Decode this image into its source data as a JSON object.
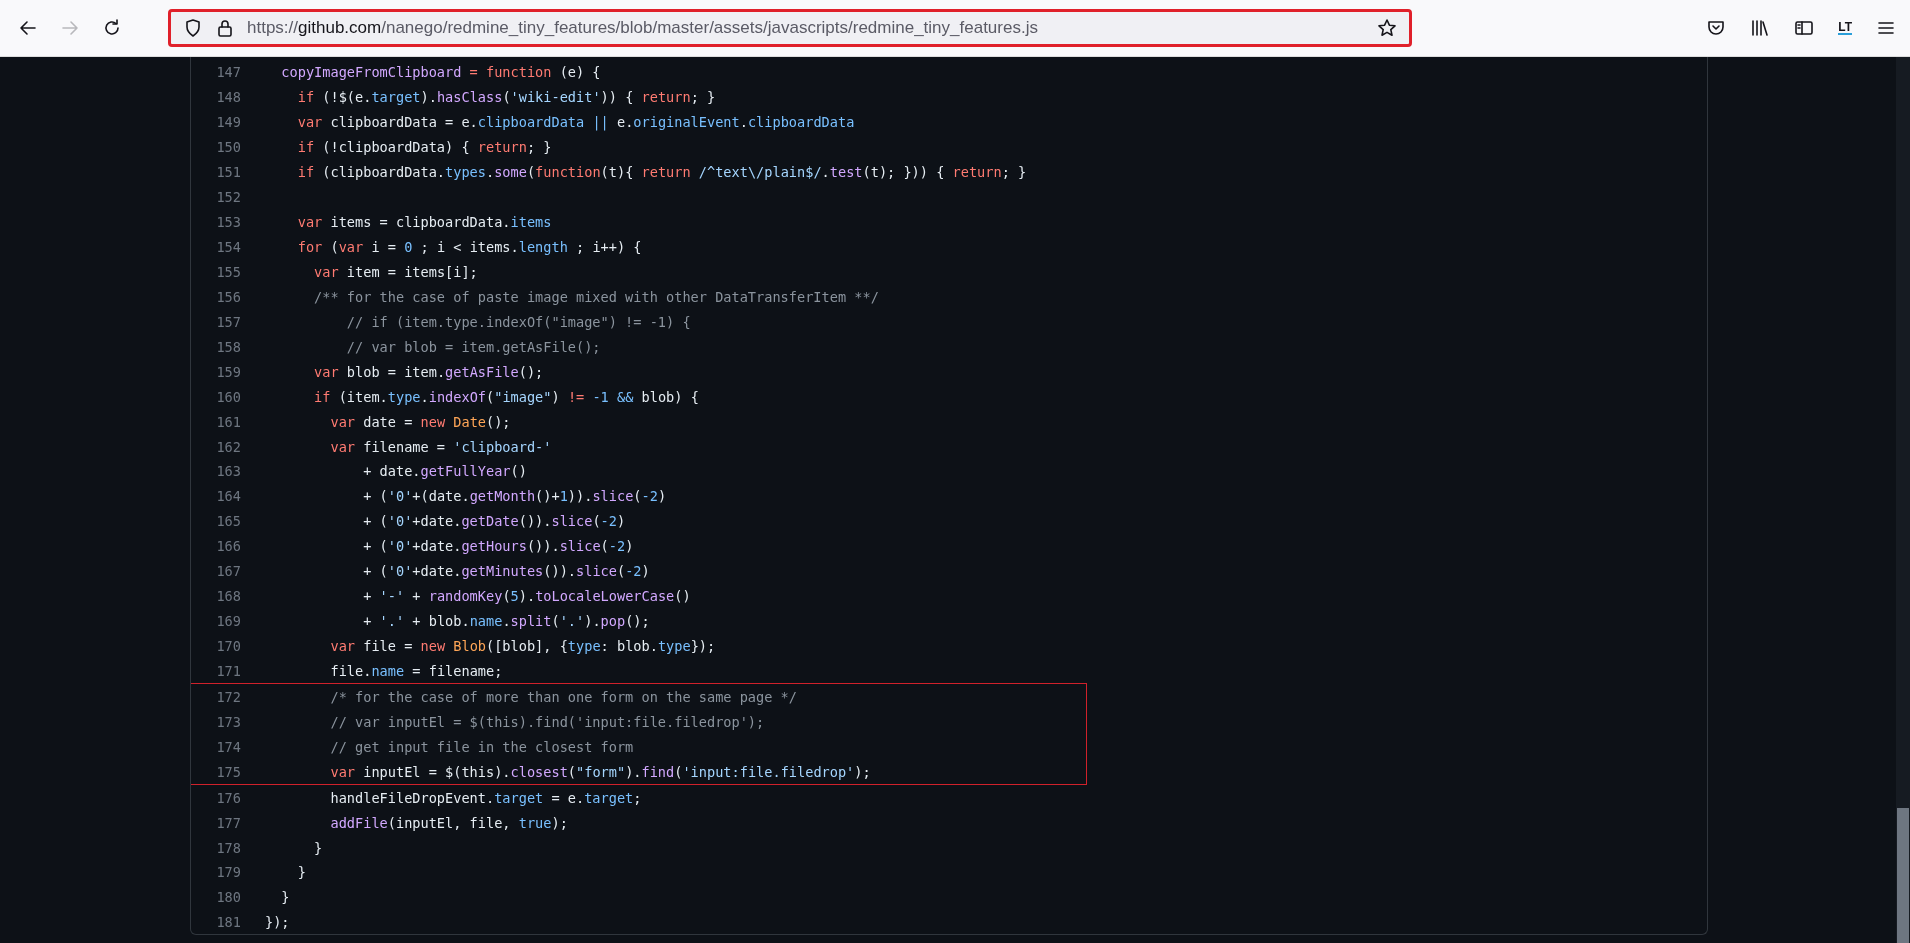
{
  "toolbar": {
    "forward_disabled": true,
    "address_bar": {
      "highlighted": true,
      "url_scheme": "https://",
      "url_host": "github.com",
      "url_path": "/nanego/redmine_tiny_features/blob/master/assets/javascripts/redmine_tiny_features.js"
    },
    "extension_label": "LT"
  },
  "code": {
    "lines": [
      {
        "number": "147",
        "boxed": false,
        "tokens": [
          {
            "kind": "fn",
            "text": "  copyImageFromClipboard"
          },
          {
            "kind": "kw",
            "text": " = function"
          },
          {
            "kind": "txt",
            "text": " (e) {"
          }
        ]
      },
      {
        "number": "148",
        "boxed": false,
        "tokens": [
          {
            "kind": "kw",
            "text": "    if"
          },
          {
            "kind": "txt",
            "text": " (!$(e."
          },
          {
            "kind": "prop",
            "text": "target"
          },
          {
            "kind": "txt",
            "text": ")."
          },
          {
            "kind": "fn",
            "text": "hasClass"
          },
          {
            "kind": "txt",
            "text": "("
          },
          {
            "kind": "str",
            "text": "'wiki-edit'"
          },
          {
            "kind": "txt",
            "text": ")) { "
          },
          {
            "kind": "kw",
            "text": "return"
          },
          {
            "kind": "txt",
            "text": "; }"
          }
        ]
      },
      {
        "number": "149",
        "boxed": false,
        "tokens": [
          {
            "kind": "kw",
            "text": "    var"
          },
          {
            "kind": "txt",
            "text": " clipboardData = e."
          },
          {
            "kind": "prop",
            "text": "clipboardData"
          },
          {
            "kind": "prop",
            "text": " ||"
          },
          {
            "kind": "txt",
            "text": " e."
          },
          {
            "kind": "prop",
            "text": "originalEvent"
          },
          {
            "kind": "txt",
            "text": "."
          },
          {
            "kind": "prop",
            "text": "clipboardData"
          }
        ]
      },
      {
        "number": "150",
        "boxed": false,
        "tokens": [
          {
            "kind": "kw",
            "text": "    if"
          },
          {
            "kind": "txt",
            "text": " (!clipboardData) { "
          },
          {
            "kind": "kw",
            "text": "return"
          },
          {
            "kind": "txt",
            "text": "; }"
          }
        ]
      },
      {
        "number": "151",
        "boxed": false,
        "tokens": [
          {
            "kind": "kw",
            "text": "    if"
          },
          {
            "kind": "txt",
            "text": " (clipboardData."
          },
          {
            "kind": "prop",
            "text": "types"
          },
          {
            "kind": "txt",
            "text": "."
          },
          {
            "kind": "fn",
            "text": "some"
          },
          {
            "kind": "txt",
            "text": "("
          },
          {
            "kind": "kw",
            "text": "function"
          },
          {
            "kind": "txt",
            "text": "(t){ "
          },
          {
            "kind": "kw",
            "text": "return"
          },
          {
            "kind": "str",
            "text": " /^text\\/plain$/"
          },
          {
            "kind": "txt",
            "text": "."
          },
          {
            "kind": "fn",
            "text": "test"
          },
          {
            "kind": "txt",
            "text": "(t); })) { "
          },
          {
            "kind": "kw",
            "text": "return"
          },
          {
            "kind": "txt",
            "text": "; }"
          }
        ]
      },
      {
        "number": "152",
        "boxed": false
      },
      {
        "number": "153",
        "boxed": false,
        "tokens": [
          {
            "kind": "kw",
            "text": "    var"
          },
          {
            "kind": "txt",
            "text": " items = clipboardData."
          },
          {
            "kind": "prop",
            "text": "items"
          }
        ]
      },
      {
        "number": "154",
        "boxed": false,
        "tokens": [
          {
            "kind": "kw",
            "text": "    for"
          },
          {
            "kind": "txt",
            "text": " ("
          },
          {
            "kind": "kw",
            "text": "var"
          },
          {
            "kind": "txt",
            "text": " i = "
          },
          {
            "kind": "num",
            "text": "0"
          },
          {
            "kind": "txt",
            "text": " ; i < items."
          },
          {
            "kind": "prop",
            "text": "length"
          },
          {
            "kind": "txt",
            "text": " ; i++) {"
          }
        ]
      },
      {
        "number": "155",
        "boxed": false,
        "tokens": [
          {
            "kind": "kw",
            "text": "      var"
          },
          {
            "kind": "txt",
            "text": " item = items[i];"
          }
        ]
      },
      {
        "number": "156",
        "boxed": false,
        "tokens": [
          {
            "kind": "cmt",
            "text": "      /** for the case of paste image mixed with other DataTransferItem **/"
          }
        ]
      },
      {
        "number": "157",
        "boxed": false,
        "tokens": [
          {
            "kind": "cmt",
            "text": "          // if (item.type.indexOf(\"image\") != -1) {"
          }
        ]
      },
      {
        "number": "158",
        "boxed": false,
        "tokens": [
          {
            "kind": "cmt",
            "text": "          // var blob = item.getAsFile();"
          }
        ]
      },
      {
        "number": "159",
        "boxed": false,
        "tokens": [
          {
            "kind": "kw",
            "text": "      var"
          },
          {
            "kind": "txt",
            "text": " blob = item."
          },
          {
            "kind": "fn",
            "text": "getAsFile"
          },
          {
            "kind": "txt",
            "text": "();"
          }
        ]
      },
      {
        "number": "160",
        "boxed": false,
        "tokens": [
          {
            "kind": "kw",
            "text": "      if"
          },
          {
            "kind": "txt",
            "text": " (item."
          },
          {
            "kind": "prop",
            "text": "type"
          },
          {
            "kind": "txt",
            "text": "."
          },
          {
            "kind": "fn",
            "text": "indexOf"
          },
          {
            "kind": "txt",
            "text": "("
          },
          {
            "kind": "str",
            "text": "\"image\""
          },
          {
            "kind": "txt",
            "text": ") "
          },
          {
            "kind": "kw",
            "text": "!="
          },
          {
            "kind": "num",
            "text": " -1"
          },
          {
            "kind": "prop",
            "text": " &&"
          },
          {
            "kind": "txt",
            "text": " blob) {"
          }
        ]
      },
      {
        "number": "161",
        "boxed": false,
        "tokens": [
          {
            "kind": "kw",
            "text": "        var"
          },
          {
            "kind": "txt",
            "text": " date = "
          },
          {
            "kind": "kw",
            "text": "new"
          },
          {
            "kind": "cls",
            "text": " Date"
          },
          {
            "kind": "txt",
            "text": "();"
          }
        ]
      },
      {
        "number": "162",
        "boxed": false,
        "tokens": [
          {
            "kind": "kw",
            "text": "        var"
          },
          {
            "kind": "txt",
            "text": " filename = "
          },
          {
            "kind": "str",
            "text": "'clipboard-'"
          }
        ]
      },
      {
        "number": "163",
        "boxed": false,
        "tokens": [
          {
            "kind": "txt",
            "text": "            + date."
          },
          {
            "kind": "fn",
            "text": "getFullYear"
          },
          {
            "kind": "txt",
            "text": "()"
          }
        ]
      },
      {
        "number": "164",
        "boxed": false,
        "tokens": [
          {
            "kind": "txt",
            "text": "            + ("
          },
          {
            "kind": "str",
            "text": "'0'"
          },
          {
            "kind": "txt",
            "text": "+(date."
          },
          {
            "kind": "fn",
            "text": "getMonth"
          },
          {
            "kind": "txt",
            "text": "()+"
          },
          {
            "kind": "num",
            "text": "1"
          },
          {
            "kind": "txt",
            "text": "))."
          },
          {
            "kind": "fn",
            "text": "slice"
          },
          {
            "kind": "txt",
            "text": "("
          },
          {
            "kind": "num",
            "text": "-2"
          },
          {
            "kind": "txt",
            "text": ")"
          }
        ]
      },
      {
        "number": "165",
        "boxed": false,
        "tokens": [
          {
            "kind": "txt",
            "text": "            + ("
          },
          {
            "kind": "str",
            "text": "'0'"
          },
          {
            "kind": "txt",
            "text": "+date."
          },
          {
            "kind": "fn",
            "text": "getDate"
          },
          {
            "kind": "txt",
            "text": "())."
          },
          {
            "kind": "fn",
            "text": "slice"
          },
          {
            "kind": "txt",
            "text": "("
          },
          {
            "kind": "num",
            "text": "-2"
          },
          {
            "kind": "txt",
            "text": ")"
          }
        ]
      },
      {
        "number": "166",
        "boxed": false,
        "tokens": [
          {
            "kind": "txt",
            "text": "            + ("
          },
          {
            "kind": "str",
            "text": "'0'"
          },
          {
            "kind": "txt",
            "text": "+date."
          },
          {
            "kind": "fn",
            "text": "getHours"
          },
          {
            "kind": "txt",
            "text": "())."
          },
          {
            "kind": "fn",
            "text": "slice"
          },
          {
            "kind": "txt",
            "text": "("
          },
          {
            "kind": "num",
            "text": "-2"
          },
          {
            "kind": "txt",
            "text": ")"
          }
        ]
      },
      {
        "number": "167",
        "boxed": false,
        "tokens": [
          {
            "kind": "txt",
            "text": "            + ("
          },
          {
            "kind": "str",
            "text": "'0'"
          },
          {
            "kind": "txt",
            "text": "+date."
          },
          {
            "kind": "fn",
            "text": "getMinutes"
          },
          {
            "kind": "txt",
            "text": "())."
          },
          {
            "kind": "fn",
            "text": "slice"
          },
          {
            "kind": "txt",
            "text": "("
          },
          {
            "kind": "num",
            "text": "-2"
          },
          {
            "kind": "txt",
            "text": ")"
          }
        ]
      },
      {
        "number": "168",
        "boxed": false,
        "tokens": [
          {
            "kind": "txt",
            "text": "            + "
          },
          {
            "kind": "str",
            "text": "'-'"
          },
          {
            "kind": "txt",
            "text": " + "
          },
          {
            "kind": "fn",
            "text": "randomKey"
          },
          {
            "kind": "txt",
            "text": "("
          },
          {
            "kind": "num",
            "text": "5"
          },
          {
            "kind": "txt",
            "text": ")."
          },
          {
            "kind": "fn",
            "text": "toLocaleLowerCase"
          },
          {
            "kind": "txt",
            "text": "()"
          }
        ]
      },
      {
        "number": "169",
        "boxed": false,
        "tokens": [
          {
            "kind": "txt",
            "text": "            + "
          },
          {
            "kind": "str",
            "text": "'.'"
          },
          {
            "kind": "txt",
            "text": " + blob."
          },
          {
            "kind": "prop",
            "text": "name"
          },
          {
            "kind": "txt",
            "text": "."
          },
          {
            "kind": "fn",
            "text": "split"
          },
          {
            "kind": "txt",
            "text": "("
          },
          {
            "kind": "str",
            "text": "'.'"
          },
          {
            "kind": "txt",
            "text": ")."
          },
          {
            "kind": "fn",
            "text": "pop"
          },
          {
            "kind": "txt",
            "text": "();"
          }
        ]
      },
      {
        "number": "170",
        "boxed": false,
        "tokens": [
          {
            "kind": "kw",
            "text": "        var"
          },
          {
            "kind": "txt",
            "text": " file = "
          },
          {
            "kind": "kw",
            "text": "new"
          },
          {
            "kind": "cls",
            "text": " Blob"
          },
          {
            "kind": "txt",
            "text": "([blob], {"
          },
          {
            "kind": "prop",
            "text": "type"
          },
          {
            "kind": "txt",
            "text": ": blob."
          },
          {
            "kind": "prop",
            "text": "type"
          },
          {
            "kind": "txt",
            "text": "});"
          }
        ]
      },
      {
        "number": "171",
        "boxed": false,
        "tokens": [
          {
            "kind": "txt",
            "text": "        file."
          },
          {
            "kind": "prop",
            "text": "name"
          },
          {
            "kind": "txt",
            "text": " = filename;"
          }
        ]
      },
      {
        "number": "172",
        "boxed": true,
        "tokens": [
          {
            "kind": "cmt",
            "text": "        /* for the case of more than one form on the same page */"
          }
        ]
      },
      {
        "number": "173",
        "boxed": true,
        "tokens": [
          {
            "kind": "cmt",
            "text": "        // var inputEl = $(this).find('input:file.filedrop');"
          }
        ]
      },
      {
        "number": "174",
        "boxed": true,
        "tokens": [
          {
            "kind": "cmt",
            "text": "        // get input file in the closest form"
          }
        ]
      },
      {
        "number": "175",
        "boxed": true,
        "tokens": [
          {
            "kind": "kw",
            "text": "        var"
          },
          {
            "kind": "txt",
            "text": " inputEl = $(this)."
          },
          {
            "kind": "fn",
            "text": "closest"
          },
          {
            "kind": "txt",
            "text": "("
          },
          {
            "kind": "str",
            "text": "\"form\""
          },
          {
            "kind": "txt",
            "text": ")."
          },
          {
            "kind": "fn",
            "text": "find"
          },
          {
            "kind": "txt",
            "text": "("
          },
          {
            "kind": "str",
            "text": "'input:file.filedrop'"
          },
          {
            "kind": "txt",
            "text": ");"
          }
        ]
      },
      {
        "number": "176",
        "boxed": false,
        "tokens": [
          {
            "kind": "txt",
            "text": "        handleFileDropEvent."
          },
          {
            "kind": "prop",
            "text": "target"
          },
          {
            "kind": "txt",
            "text": " = e."
          },
          {
            "kind": "prop",
            "text": "target"
          },
          {
            "kind": "txt",
            "text": ";"
          }
        ]
      },
      {
        "number": "177",
        "boxed": false,
        "tokens": [
          {
            "kind": "fn",
            "text": "        addFile"
          },
          {
            "kind": "txt",
            "text": "(inputEl, file, "
          },
          {
            "kind": "num",
            "text": "true"
          },
          {
            "kind": "txt",
            "text": ");"
          }
        ]
      },
      {
        "number": "178",
        "boxed": false,
        "tokens": [
          {
            "kind": "txt",
            "text": "      }"
          }
        ]
      },
      {
        "number": "179",
        "boxed": false,
        "tokens": [
          {
            "kind": "txt",
            "text": "    }"
          }
        ]
      },
      {
        "number": "180",
        "boxed": false,
        "tokens": [
          {
            "kind": "txt",
            "text": "  }"
          }
        ]
      },
      {
        "number": "181",
        "boxed": false,
        "tokens": [
          {
            "kind": "txt",
            "text": "});"
          }
        ]
      }
    ]
  }
}
